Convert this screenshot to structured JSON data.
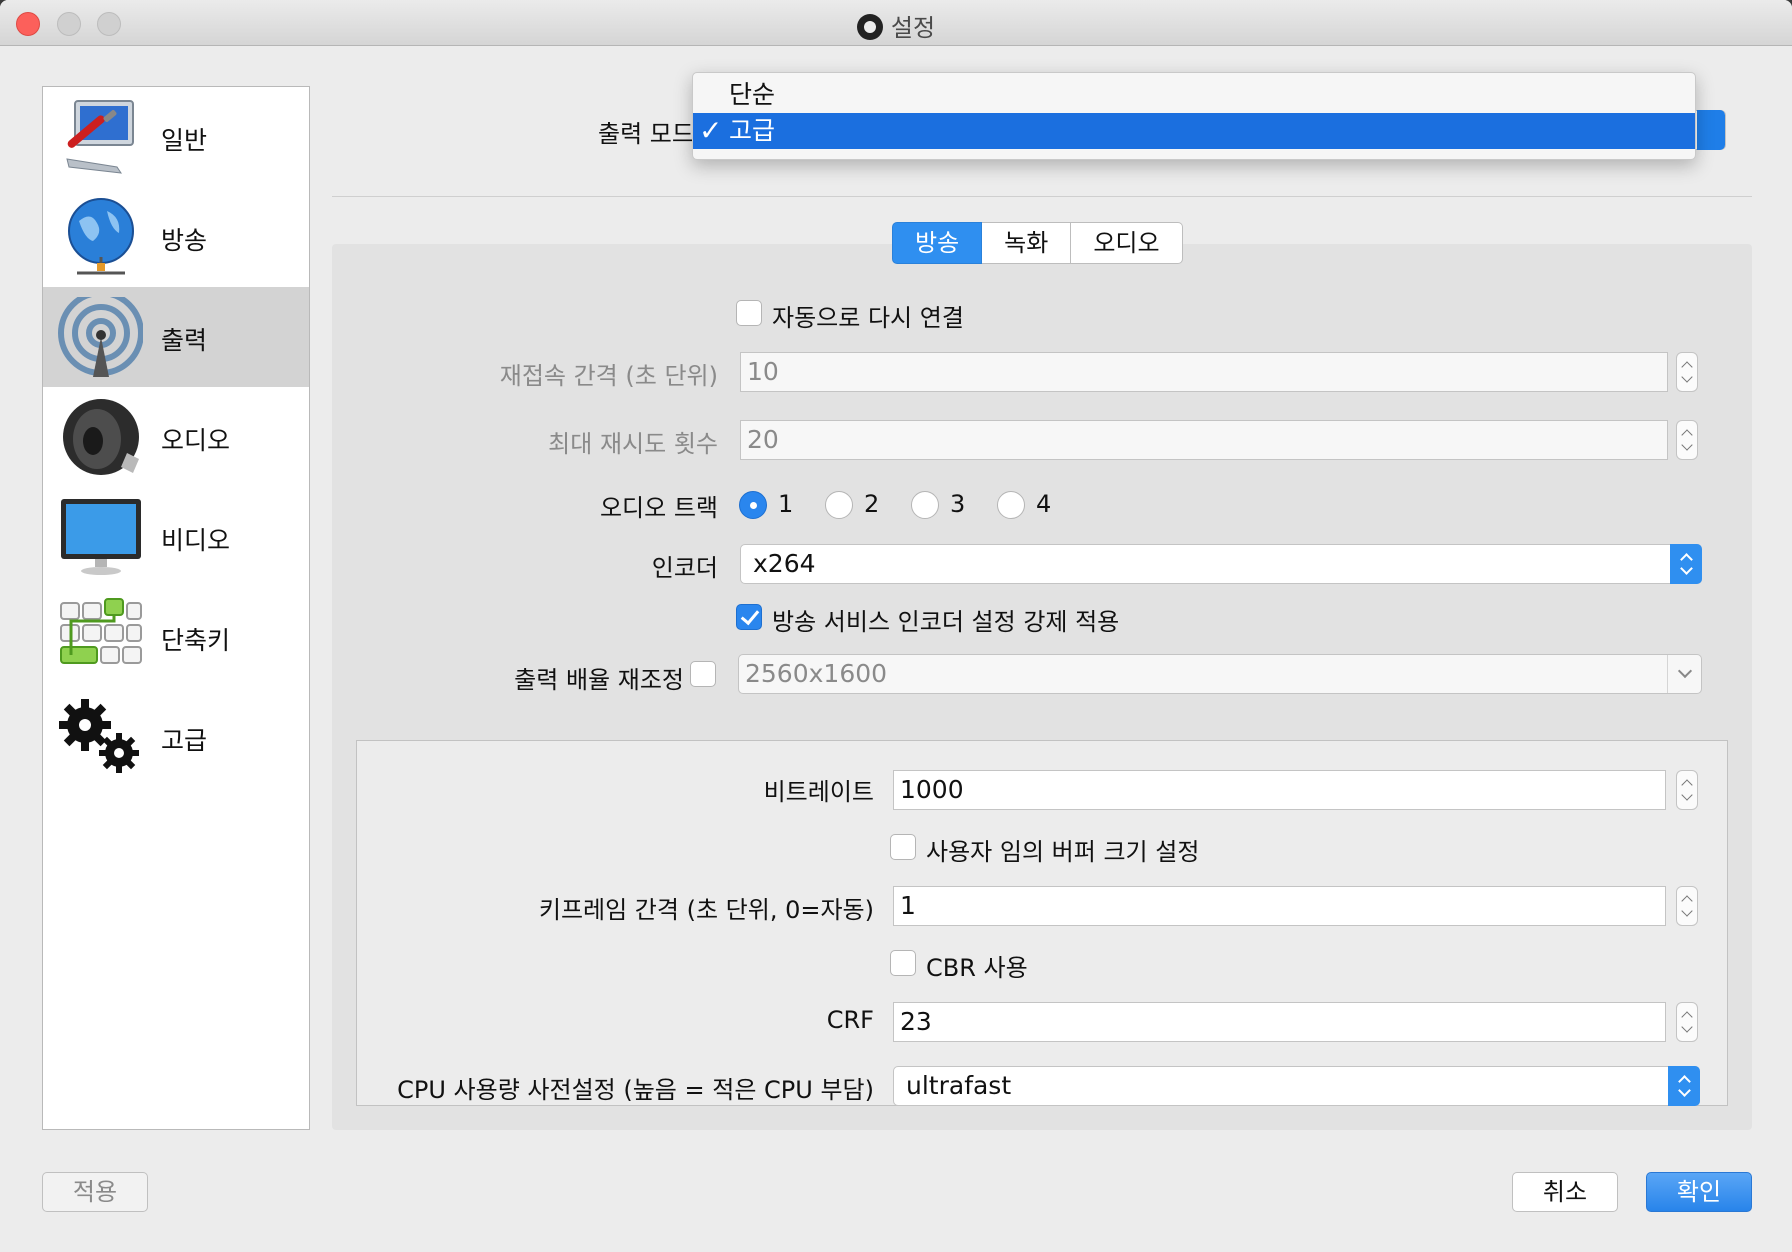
{
  "window": {
    "title": "설정"
  },
  "sidebar": {
    "items": [
      {
        "label": "일반",
        "icon": "general-settings-icon"
      },
      {
        "label": "방송",
        "icon": "globe-icon"
      },
      {
        "label": "출력",
        "icon": "broadcast-icon"
      },
      {
        "label": "오디오",
        "icon": "speaker-icon"
      },
      {
        "label": "비디오",
        "icon": "monitor-icon"
      },
      {
        "label": "단축키",
        "icon": "keyboard-icon"
      },
      {
        "label": "고급",
        "icon": "gears-icon"
      }
    ],
    "active_index": 2
  },
  "output_mode": {
    "label": "출력 모드",
    "options": [
      "단순",
      "고급"
    ],
    "selected": "고급"
  },
  "tabs": [
    "방송",
    "녹화",
    "오디오"
  ],
  "active_tab": "방송",
  "stream": {
    "auto_reconnect_label": "자동으로 다시 연결",
    "auto_reconnect_checked": false,
    "retry_delay_label": "재접속 간격 (초 단위)",
    "retry_delay_value": "10",
    "max_retries_label": "최대 재시도 횟수",
    "max_retries_value": "20",
    "audio_track_label": "오디오 트랙",
    "audio_tracks": [
      "1",
      "2",
      "3",
      "4"
    ],
    "audio_track_selected": "1",
    "encoder_label": "인코더",
    "encoder_value": "x264",
    "enforce_label": "방송 서비스 인코더 설정 강제 적용",
    "enforce_checked": true,
    "rescale_label": "출력  배율 재조정",
    "rescale_checked": false,
    "rescale_value": "2560x1600"
  },
  "encoder_settings": {
    "bitrate_label": "비트레이트",
    "bitrate_value": "1000",
    "custom_buffer_label": "사용자 임의 버퍼  크기 설정",
    "custom_buffer_checked": false,
    "keyframe_label": "키프레임 간격 (초 단위, 0=자동)",
    "keyframe_value": "1",
    "cbr_label": "CBR 사용",
    "cbr_checked": false,
    "crf_label": "CRF",
    "crf_value": "23",
    "preset_label": "CPU 사용량 사전설정 (높음 = 적은 CPU 부담)",
    "preset_value": "ultrafast"
  },
  "buttons": {
    "apply": "적용",
    "cancel": "취소",
    "ok": "확인"
  },
  "colors": {
    "accent": "#2f8ff0",
    "selected_row": "#1b6fdf"
  }
}
